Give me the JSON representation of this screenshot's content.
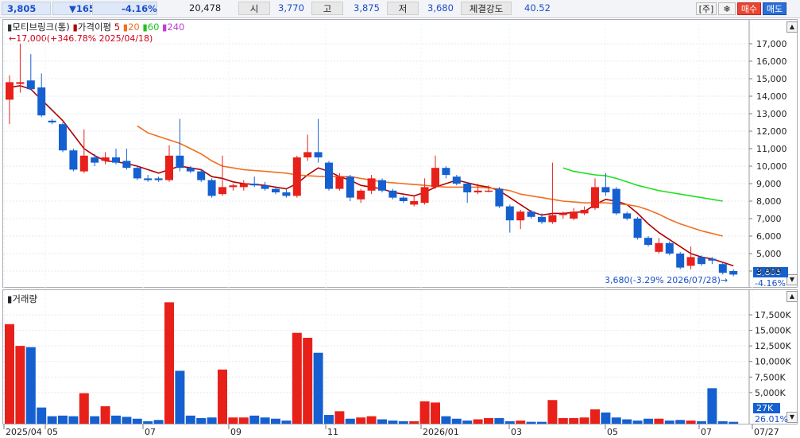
{
  "header": {
    "price": "3,805",
    "change": "▼165",
    "change_pct": "-4.16%",
    "volume": "20,478",
    "open_label": "시",
    "open": "3,770",
    "high_label": "고",
    "high": "3,875",
    "low_label": "저",
    "low": "3,680",
    "strength_label": "체결강도",
    "strength": "40.52",
    "btn_stock": "[주]",
    "btn_settings": "❄",
    "btn_buy": "매수",
    "btn_sell": "매도"
  },
  "legend": {
    "name": "모티브링크(통)",
    "ma_label": "가격이평",
    "ma5": "5",
    "ma20": "20",
    "ma60": "60",
    "ma240": "240"
  },
  "colors": {
    "up": "#e8201a",
    "down": "#1560d0",
    "ma5": "#b00000",
    "ma20": "#f07020",
    "ma60": "#20e020",
    "ma240": "#c040d0"
  },
  "annotations": {
    "max_label": "←17,000(+346.78% 2025/04/18)",
    "min_label": "3,680(-3.29% 2026/07/28)→",
    "price_badge": "3,805",
    "price_badge_pct": "-4.16%",
    "vol_badge": "27K",
    "vol_badge_pct": "26.01%"
  },
  "volume_label": "거래량",
  "price_axis": [
    "17,000",
    "16,000",
    "15,000",
    "14,000",
    "13,000",
    "12,000",
    "11,000",
    "10,000",
    "9,000",
    "8,000",
    "7,000",
    "6,000",
    "5,000",
    "4,000"
  ],
  "volume_axis": [
    "17,500K",
    "15,000K",
    "12,500K",
    "10,000K",
    "7,500K",
    "5,000K"
  ],
  "x_axis": [
    "2025/04",
    "05",
    "07",
    "09",
    "11",
    "2026/01",
    "03",
    "05",
    "07",
    "07/27"
  ],
  "chart_data": {
    "type": "candlestick",
    "ylim": [
      3400,
      17900
    ],
    "volume_ylim": [
      0,
      19800
    ],
    "candles": [
      {
        "o": 13800,
        "h": 15200,
        "l": 12400,
        "c": 14800,
        "v": 16000
      },
      {
        "o": 14700,
        "h": 17000,
        "l": 14200,
        "c": 14800,
        "v": 12500
      },
      {
        "o": 14900,
        "h": 16400,
        "l": 14400,
        "c": 14400,
        "v": 12300
      },
      {
        "o": 14500,
        "h": 15300,
        "l": 12800,
        "c": 12900,
        "v": 2600
      },
      {
        "o": 12600,
        "h": 12700,
        "l": 12400,
        "c": 12500,
        "v": 1200
      },
      {
        "o": 12400,
        "h": 12500,
        "l": 10800,
        "c": 10900,
        "v": 1300
      },
      {
        "o": 10900,
        "h": 11000,
        "l": 9700,
        "c": 9800,
        "v": 1200
      },
      {
        "o": 9700,
        "h": 12100,
        "l": 9600,
        "c": 10600,
        "v": 4900
      },
      {
        "o": 10500,
        "h": 10700,
        "l": 10000,
        "c": 10200,
        "v": 1200
      },
      {
        "o": 10300,
        "h": 10800,
        "l": 10100,
        "c": 10500,
        "v": 2800
      },
      {
        "o": 10500,
        "h": 11000,
        "l": 10100,
        "c": 10200,
        "v": 1300
      },
      {
        "o": 10300,
        "h": 11000,
        "l": 9800,
        "c": 9900,
        "v": 1100
      },
      {
        "o": 9900,
        "h": 10000,
        "l": 9200,
        "c": 9300,
        "v": 800
      },
      {
        "o": 9300,
        "h": 9500,
        "l": 9100,
        "c": 9200,
        "v": 400
      },
      {
        "o": 9300,
        "h": 9400,
        "l": 9100,
        "c": 9200,
        "v": 600
      },
      {
        "o": 9200,
        "h": 11200,
        "l": 9100,
        "c": 10600,
        "v": 19500
      },
      {
        "o": 10600,
        "h": 12700,
        "l": 9700,
        "c": 9900,
        "v": 8500
      },
      {
        "o": 9900,
        "h": 10000,
        "l": 9600,
        "c": 9700,
        "v": 1300
      },
      {
        "o": 9700,
        "h": 9800,
        "l": 9100,
        "c": 9200,
        "v": 900
      },
      {
        "o": 9200,
        "h": 9300,
        "l": 8200,
        "c": 8300,
        "v": 1000
      },
      {
        "o": 8400,
        "h": 10600,
        "l": 8300,
        "c": 8800,
        "v": 8700
      },
      {
        "o": 8800,
        "h": 9000,
        "l": 8600,
        "c": 8900,
        "v": 1000
      },
      {
        "o": 8800,
        "h": 9200,
        "l": 8600,
        "c": 9000,
        "v": 1000
      },
      {
        "o": 9000,
        "h": 9400,
        "l": 8800,
        "c": 8900,
        "v": 1300
      },
      {
        "o": 8900,
        "h": 9100,
        "l": 8600,
        "c": 8700,
        "v": 1000
      },
      {
        "o": 8700,
        "h": 8800,
        "l": 8400,
        "c": 8500,
        "v": 800
      },
      {
        "o": 8500,
        "h": 8700,
        "l": 8200,
        "c": 8300,
        "v": 500
      },
      {
        "o": 8300,
        "h": 10600,
        "l": 8200,
        "c": 10500,
        "v": 14600
      },
      {
        "o": 10500,
        "h": 11800,
        "l": 10300,
        "c": 10800,
        "v": 13800
      },
      {
        "o": 10800,
        "h": 12700,
        "l": 10200,
        "c": 10500,
        "v": 11400
      },
      {
        "o": 10200,
        "h": 10300,
        "l": 8600,
        "c": 8700,
        "v": 1400
      },
      {
        "o": 8700,
        "h": 9600,
        "l": 8600,
        "c": 9400,
        "v": 2000
      },
      {
        "o": 9400,
        "h": 9500,
        "l": 8000,
        "c": 8200,
        "v": 800
      },
      {
        "o": 8100,
        "h": 8700,
        "l": 7900,
        "c": 8600,
        "v": 1000
      },
      {
        "o": 8600,
        "h": 9500,
        "l": 8400,
        "c": 9300,
        "v": 1200
      },
      {
        "o": 9200,
        "h": 9300,
        "l": 8500,
        "c": 8600,
        "v": 700
      },
      {
        "o": 8600,
        "h": 8700,
        "l": 8100,
        "c": 8200,
        "v": 500
      },
      {
        "o": 8200,
        "h": 8300,
        "l": 7900,
        "c": 8000,
        "v": 400
      },
      {
        "o": 7800,
        "h": 8300,
        "l": 7700,
        "c": 8000,
        "v": 400
      },
      {
        "o": 7900,
        "h": 9300,
        "l": 7800,
        "c": 8800,
        "v": 3600
      },
      {
        "o": 8800,
        "h": 10600,
        "l": 8700,
        "c": 9900,
        "v": 3400
      },
      {
        "o": 9900,
        "h": 10000,
        "l": 9300,
        "c": 9500,
        "v": 1200
      },
      {
        "o": 9400,
        "h": 9500,
        "l": 8900,
        "c": 9000,
        "v": 800
      },
      {
        "o": 9000,
        "h": 9100,
        "l": 7900,
        "c": 8500,
        "v": 500
      },
      {
        "o": 8500,
        "h": 9000,
        "l": 8400,
        "c": 8600,
        "v": 700
      },
      {
        "o": 8600,
        "h": 8900,
        "l": 8500,
        "c": 8600,
        "v": 900
      },
      {
        "o": 8700,
        "h": 8800,
        "l": 7600,
        "c": 7700,
        "v": 900
      },
      {
        "o": 7700,
        "h": 7800,
        "l": 6200,
        "c": 6900,
        "v": 400
      },
      {
        "o": 6900,
        "h": 7500,
        "l": 6400,
        "c": 7400,
        "v": 500
      },
      {
        "o": 7400,
        "h": 7500,
        "l": 7000,
        "c": 7100,
        "v": 300
      },
      {
        "o": 7100,
        "h": 7300,
        "l": 6700,
        "c": 6800,
        "v": 300
      },
      {
        "o": 6800,
        "h": 10200,
        "l": 6700,
        "c": 7200,
        "v": 3800
      },
      {
        "o": 7200,
        "h": 7400,
        "l": 7000,
        "c": 7300,
        "v": 900
      },
      {
        "o": 7000,
        "h": 7600,
        "l": 6900,
        "c": 7400,
        "v": 900
      },
      {
        "o": 7300,
        "h": 7700,
        "l": 7200,
        "c": 7500,
        "v": 1000
      },
      {
        "o": 7600,
        "h": 9300,
        "l": 7500,
        "c": 8800,
        "v": 2300
      },
      {
        "o": 8800,
        "h": 9600,
        "l": 8300,
        "c": 8500,
        "v": 1800
      },
      {
        "o": 8700,
        "h": 8800,
        "l": 7200,
        "c": 7300,
        "v": 1000
      },
      {
        "o": 7300,
        "h": 7400,
        "l": 6900,
        "c": 7000,
        "v": 700
      },
      {
        "o": 7000,
        "h": 7100,
        "l": 5800,
        "c": 5900,
        "v": 500
      },
      {
        "o": 5900,
        "h": 6000,
        "l": 5400,
        "c": 5500,
        "v": 800
      },
      {
        "o": 5100,
        "h": 5900,
        "l": 5000,
        "c": 5600,
        "v": 800
      },
      {
        "o": 5600,
        "h": 5700,
        "l": 4900,
        "c": 5000,
        "v": 500
      },
      {
        "o": 5000,
        "h": 5100,
        "l": 4100,
        "c": 4200,
        "v": 600
      },
      {
        "o": 4300,
        "h": 5400,
        "l": 4100,
        "c": 4800,
        "v": 500
      },
      {
        "o": 4800,
        "h": 4900,
        "l": 4300,
        "c": 4400,
        "v": 400
      },
      {
        "o": 4700,
        "h": 4800,
        "l": 4400,
        "c": 4600,
        "v": 5700
      },
      {
        "o": 4400,
        "h": 4500,
        "l": 3800,
        "c": 3900,
        "v": 400
      },
      {
        "o": 4000,
        "h": 4100,
        "l": 3700,
        "c": 3800,
        "v": 300
      }
    ],
    "ma5": [
      14500,
      14600,
      14400,
      13800,
      13200,
      12600,
      11800,
      11000,
      10600,
      10300,
      10250,
      10150,
      10000,
      9800,
      9600,
      9800,
      10000,
      9900,
      9800,
      9400,
      9300,
      9100,
      9000,
      8950,
      8900,
      8800,
      8700,
      9000,
      9500,
      9900,
      9700,
      9400,
      9200,
      8900,
      8800,
      8700,
      8500,
      8400,
      8300,
      8500,
      8800,
      9000,
      9200,
      9050,
      8900,
      8800,
      8600,
      8200,
      7800,
      7400,
      7200,
      7300,
      7300,
      7350,
      7400,
      7800,
      8100,
      8000,
      7800,
      7300,
      6700,
      6200,
      5800,
      5400,
      5000,
      4800,
      4700,
      4500,
      4300
    ],
    "ma20_start": 12,
    "ma20": [
      12300,
      11900,
      11700,
      11500,
      11300,
      11000,
      10700,
      10300,
      10000,
      9900,
      9800,
      9750,
      9700,
      9650,
      9600,
      9500,
      9450,
      9420,
      9400,
      9400,
      9400,
      9300,
      9200,
      9100,
      9050,
      9000,
      8950,
      8900,
      8850,
      8800,
      8800,
      8800,
      8800,
      8750,
      8700,
      8600,
      8400,
      8300,
      8200,
      8100,
      8000,
      7950,
      7900,
      7900,
      7900,
      7850,
      7800,
      7700,
      7500,
      7250,
      6950,
      6700,
      6500,
      6300,
      6150,
      6000
    ],
    "ma60_start": 52,
    "ma60": [
      9900,
      9700,
      9600,
      9500,
      9450,
      9300,
      9100,
      8900,
      8750,
      8600,
      8500,
      8400,
      8300,
      8200,
      8100,
      8000
    ]
  }
}
